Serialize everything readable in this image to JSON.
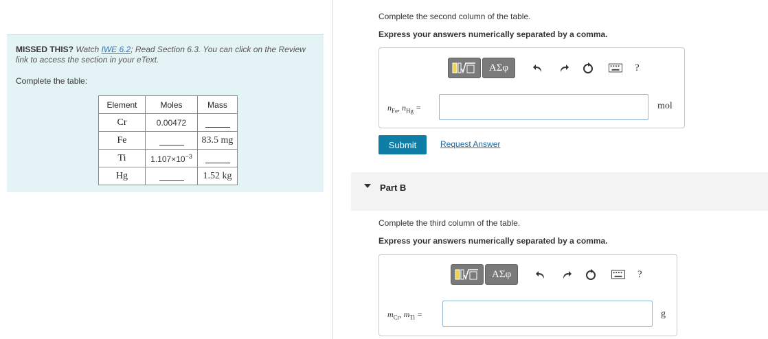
{
  "info": {
    "missed_prefix": "MISSED THIS?",
    "watch_text": "Watch",
    "iwe_link": "IWE 6.2",
    "read_text": "; Read Section 6.3. You can click on the Review link to access the section in your eText.",
    "complete_table": "Complete the table:"
  },
  "table": {
    "headers": [
      "Element",
      "Moles",
      "Mass"
    ],
    "rows": [
      {
        "element": "Cr",
        "moles": "0.00472",
        "mass": ""
      },
      {
        "element": "Fe",
        "moles": "",
        "mass": "83.5 mg"
      },
      {
        "element": "Ti",
        "moles_base": "1.107×10",
        "moles_exp": "−3",
        "mass": ""
      },
      {
        "element": "Hg",
        "moles": "",
        "mass": "1.52 kg"
      }
    ]
  },
  "partA": {
    "instruction": "Complete the second column of the table.",
    "format": "Express your answers numerically separated by a comma.",
    "toolbar": {
      "greek": "ΑΣφ",
      "help": "?"
    },
    "var_n": "n",
    "sub1": "Fe",
    "sub2": "Hg",
    "sep": ", ",
    "eq": " =",
    "unit": "mol",
    "submit": "Submit",
    "request": "Request Answer"
  },
  "partB": {
    "label": "Part B",
    "instruction": "Complete the third column of the table.",
    "format": "Express your answers numerically separated by a comma.",
    "toolbar": {
      "greek": "ΑΣφ",
      "help": "?"
    },
    "var_m": "m",
    "sub1": "Cr",
    "sub2": "Ti",
    "sep": ", ",
    "eq": " =",
    "unit": "g"
  }
}
